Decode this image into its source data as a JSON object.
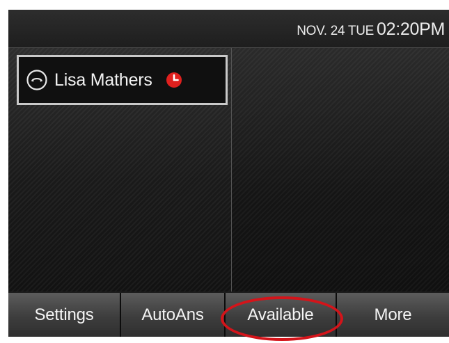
{
  "header": {
    "date": "NOV. 24 TUE",
    "time": "02:20PM"
  },
  "line": {
    "name": "Lisa Mathers",
    "icon": "handset-icon",
    "status_icon": "clock-icon",
    "status_color": "#e0201e"
  },
  "softkeys": [
    {
      "label": "Settings"
    },
    {
      "label": "AutoAns"
    },
    {
      "label": "Available"
    },
    {
      "label": "More"
    }
  ],
  "annotation": {
    "highlight_color": "#d4141a",
    "target": "Available"
  }
}
